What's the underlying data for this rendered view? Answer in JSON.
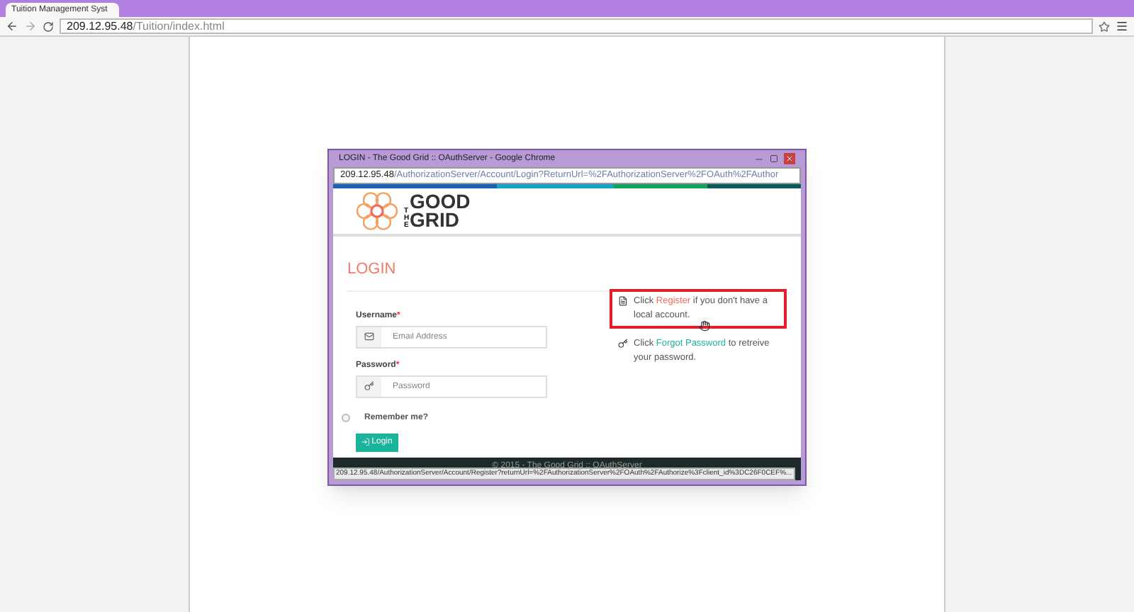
{
  "browser": {
    "tab_title": "Tuition Management Syst",
    "url_host": "209.12.95.48",
    "url_path": "/Tuition/index.html"
  },
  "popup": {
    "title": "LOGIN - The Good Grid :: OAuthServer - Google Chrome",
    "url_host": "209.12.95.48",
    "url_path": "/AuthorizationServer/Account/Login?ReturnUrl=%2FAuthorizationServer%2FOAuth%2FAuthor",
    "logo": {
      "small": "THE",
      "top": "GOOD",
      "bottom": "GRID"
    },
    "heading": "LOGIN",
    "username": {
      "label": "Username",
      "required": "*",
      "placeholder": "Email Address"
    },
    "password": {
      "label": "Password",
      "required": "*",
      "placeholder": "Password"
    },
    "remember": {
      "label": "Remember me?",
      "checked": false
    },
    "login_button": "Login",
    "register_note": {
      "before": "Click ",
      "link": "Register",
      "after": " if you don't have a local account.",
      "highlighted": true
    },
    "forgot_note": {
      "before": "Click ",
      "link": "Forgot Password",
      "after": " to retreive your password.",
      "highlighted": false
    },
    "footer": "© 2015 - The Good Grid :: OAuthServer",
    "status_url": "209.12.95.48/AuthorizationServer/Account/Register?returnUrl=%2FAuthorizationServer%2FOAuth%2FAuthorize%3Fclient_id%3DC26F0CEF%..."
  }
}
